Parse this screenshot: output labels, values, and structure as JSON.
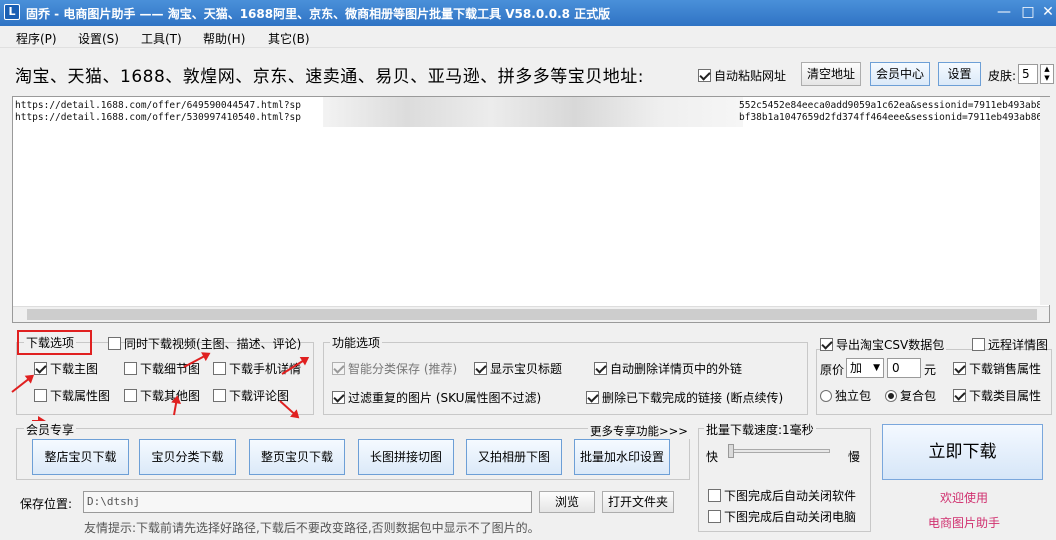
{
  "window": {
    "title": "固乔 - 电商图片助手 —— 淘宝、天猫、1688阿里、京东、微商相册等图片批量下载工具 V58.0.0.8 正式版",
    "app_icon": "L",
    "controls": {
      "minimize": "—",
      "maximize": "□",
      "close": "✕"
    }
  },
  "menu": [
    "程序(P)",
    "设置(S)",
    "工具(T)",
    "帮助(H)",
    "其它(B)"
  ],
  "site_label": "淘宝、天猫、1688、敦煌网、京东、速卖通、易贝、亚马逊、拼多多等宝贝地址:",
  "top_controls": {
    "auto_paste": "自动粘贴网址",
    "clear_btn": "清空地址",
    "member_btn": "会员中心",
    "settings_btn": "设置",
    "skin_label": "皮肤:",
    "skin_value": "5"
  },
  "urls": {
    "line1_left": "https://detail.1688.com/offer/649590044547.html?sp",
    "line1_right": "552c5452e84eeca0add9059a1c62ea&sessionid=7911eb493ab864",
    "line2_left": "https://detail.1688.com/offer/530997410540.html?sp",
    "line2_right": "bf38b1a1047659d2fd374ff464eee&sessionid=7911eb493ab864"
  },
  "download_options": {
    "title": "下载选项",
    "video": "同时下载视频(主图、描述、评论)",
    "main_img": "下载主图",
    "detail_img": "下载细节图",
    "mobile_detail": "下载手机详情",
    "attr_img": "下载属性图",
    "other_img": "下载其他图",
    "review_img": "下载评论图"
  },
  "function_options": {
    "title": "功能选项",
    "smart_save": "智能分类保存 (推荐)",
    "show_title": "显示宝贝标题",
    "auto_delete_links": "自动删除详情页中的外链",
    "filter_dup": "过滤重复的图片 (SKU属性图不过滤)",
    "delete_done": "删除已下载完成的链接 (断点续传)"
  },
  "right_options": {
    "export_csv": "导出淘宝CSV数据包",
    "remote_detail": "远程详情图",
    "price_label": "原价",
    "price_op": "加",
    "price_value": "0",
    "price_unit": "元",
    "sales_attr": "下载销售属性",
    "single_pkg": "独立包",
    "combo_pkg": "复合包",
    "category_attr": "下载类目属性"
  },
  "member": {
    "title": "会员专享",
    "more": "更多专享功能>>>",
    "buttons": [
      "整店宝贝下载",
      "宝贝分类下载",
      "整页宝贝下载",
      "长图拼接切图",
      "又拍相册下图",
      "批量加水印设置"
    ]
  },
  "speed": {
    "title": "批量下载速度:1毫秒",
    "fast": "快",
    "slow": "慢",
    "value_fraction": 0.0,
    "close_software": "下图完成后自动关闭软件",
    "close_computer": "下图完成后自动关闭电脑"
  },
  "download_btn": "立即下载",
  "welcome1": "欢迎使用",
  "welcome2": "电商图片助手",
  "save": {
    "label": "保存位置:",
    "path": "D:\\dtshj",
    "browse": "浏览",
    "open_folder": "打开文件夹",
    "tip": "友情提示:下载前请先选择好路径,下载后不要改变路径,否则数据包中显示不了图片的。"
  },
  "colors": {
    "titlebar": "#2f73c4",
    "annotation_red": "#e02020",
    "welcome_pink": "#d0306f"
  }
}
